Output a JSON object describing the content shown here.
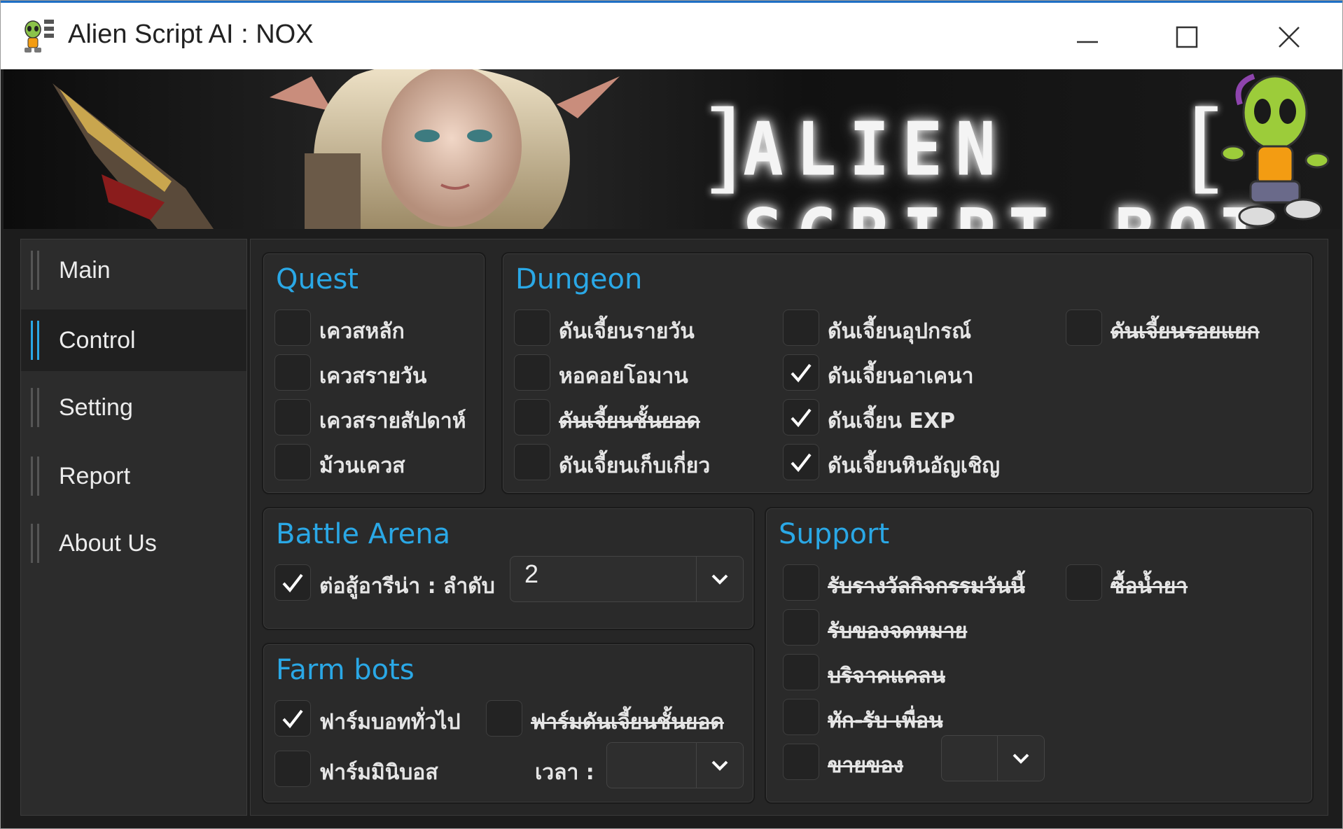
{
  "window": {
    "title": "Alien Script AI : NOX",
    "accent_color": "#2aa8e6"
  },
  "banner": {
    "title": "ALIEN SCRIPT BOT"
  },
  "sidebar": {
    "items": [
      {
        "label": "Main",
        "active": false
      },
      {
        "label": "Control",
        "active": true
      },
      {
        "label": "Setting",
        "active": false
      },
      {
        "label": "Report",
        "active": false
      },
      {
        "label": "About Us",
        "active": false
      }
    ]
  },
  "quest": {
    "title": "Quest",
    "items": [
      {
        "label": "เควสหลัก",
        "checked": false
      },
      {
        "label": "เควสรายวัน",
        "checked": false
      },
      {
        "label": "เควสรายสัปดาห์",
        "checked": false
      },
      {
        "label": "ม้วนเควส",
        "checked": false
      }
    ]
  },
  "dungeon": {
    "title": "Dungeon",
    "items": [
      {
        "label": "ดันเจี้ยนรายวัน",
        "checked": false,
        "disabled": false
      },
      {
        "label": "หอคอยโอมาน",
        "checked": false,
        "disabled": false
      },
      {
        "label": "ดันเจี้ยนชั้นยอด",
        "checked": false,
        "disabled": true
      },
      {
        "label": "ดันเจี้ยนเก็บเกี่ยว",
        "checked": false,
        "disabled": false
      },
      {
        "label": "ดันเจี้ยนอุปกรณ์",
        "checked": false,
        "disabled": false
      },
      {
        "label": "ดันเจี้ยนอาเคนา",
        "checked": true,
        "disabled": false
      },
      {
        "label": "ดันเจี้ยน EXP",
        "checked": true,
        "disabled": false
      },
      {
        "label": "ดันเจี้ยนหินอัญเชิญ",
        "checked": true,
        "disabled": false
      },
      {
        "label": "ดันเจี้ยนรอยแยก",
        "checked": false,
        "disabled": true
      }
    ]
  },
  "battle_arena": {
    "title": "Battle Arena",
    "arena_label": "ต่อสู้อารีน่า : ลำดับ",
    "arena_checked": true,
    "rank_value": "2"
  },
  "farm_bots": {
    "title": "Farm bots",
    "items": [
      {
        "label": "ฟาร์มบอททั่วไป",
        "checked": true,
        "disabled": false
      },
      {
        "label": "ฟาร์มดันเจี้ยนชั้นยอด",
        "checked": false,
        "disabled": true
      },
      {
        "label": "ฟาร์มมินิบอส",
        "checked": false,
        "disabled": false
      }
    ],
    "time_label": "เวลา :",
    "time_value": ""
  },
  "support": {
    "title": "Support",
    "items": [
      {
        "label": "รับรางวัลกิจกรรมวันนี้",
        "checked": false,
        "disabled": true
      },
      {
        "label": "ซื้อน้ำยา",
        "checked": false,
        "disabled": true
      },
      {
        "label": "รับของจดหมาย",
        "checked": false,
        "disabled": true
      },
      {
        "label": "บริจาคแคลน",
        "checked": false,
        "disabled": true
      },
      {
        "label": "ทัก-รับ เพื่อน",
        "checked": false,
        "disabled": true
      },
      {
        "label": "ขายของ",
        "checked": false,
        "disabled": true
      }
    ],
    "sell_value": ""
  }
}
